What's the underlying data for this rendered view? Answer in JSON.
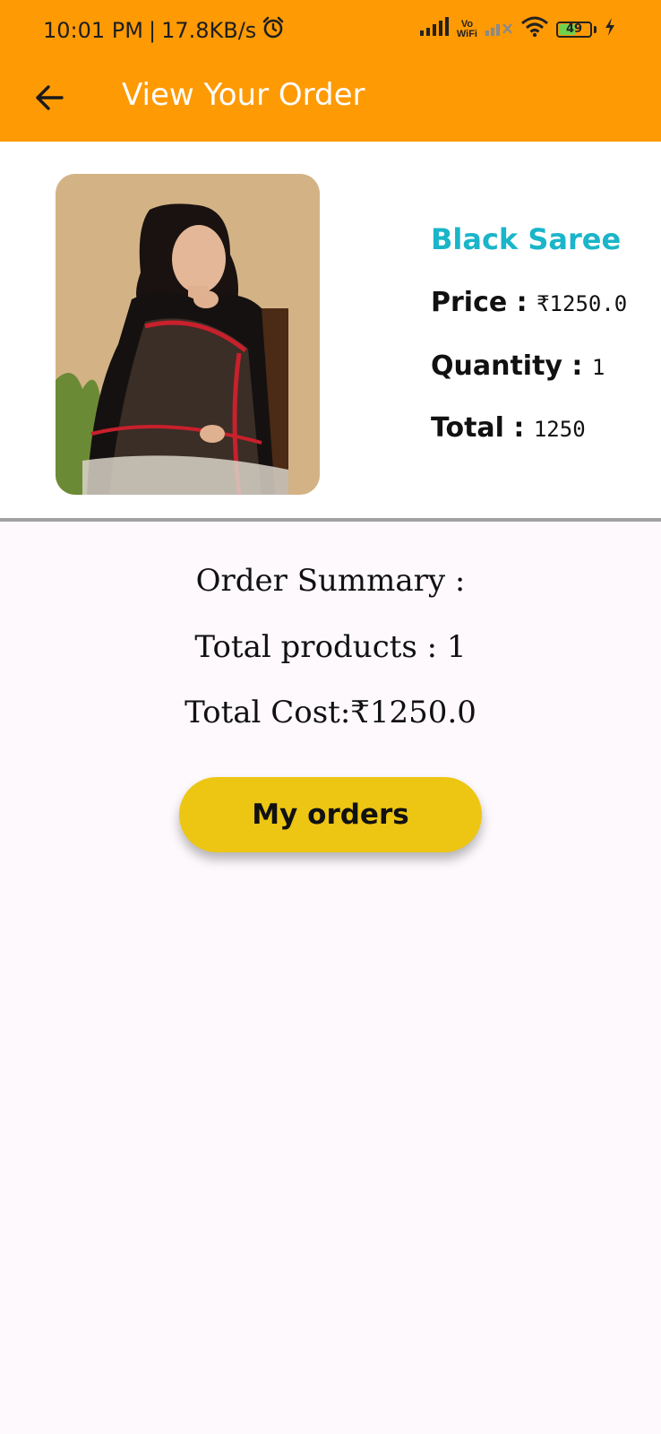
{
  "status_bar": {
    "time": "10:01 PM",
    "speed": "17.8KB/s",
    "vowifi_top": "Vo",
    "vowifi_bottom": "WiFi",
    "battery": "49"
  },
  "toolbar": {
    "title": "View Your Order"
  },
  "product": {
    "name": "Black Saree",
    "price_label": "Price : ",
    "price_value": "₹1250.0",
    "quantity_label": "Quantity : ",
    "quantity_value": "1",
    "total_label": "Total : ",
    "total_value": "1250"
  },
  "summary": {
    "heading": "Order Summary :",
    "total_products": "Total products : 1",
    "total_cost": "Total Cost:₹1250.0"
  },
  "actions": {
    "my_orders_label": "My orders"
  },
  "colors": {
    "appbar": "#fe9a04",
    "product_name": "#1ab5c9",
    "button": "#ecc613",
    "background": "#fdf9fd"
  }
}
